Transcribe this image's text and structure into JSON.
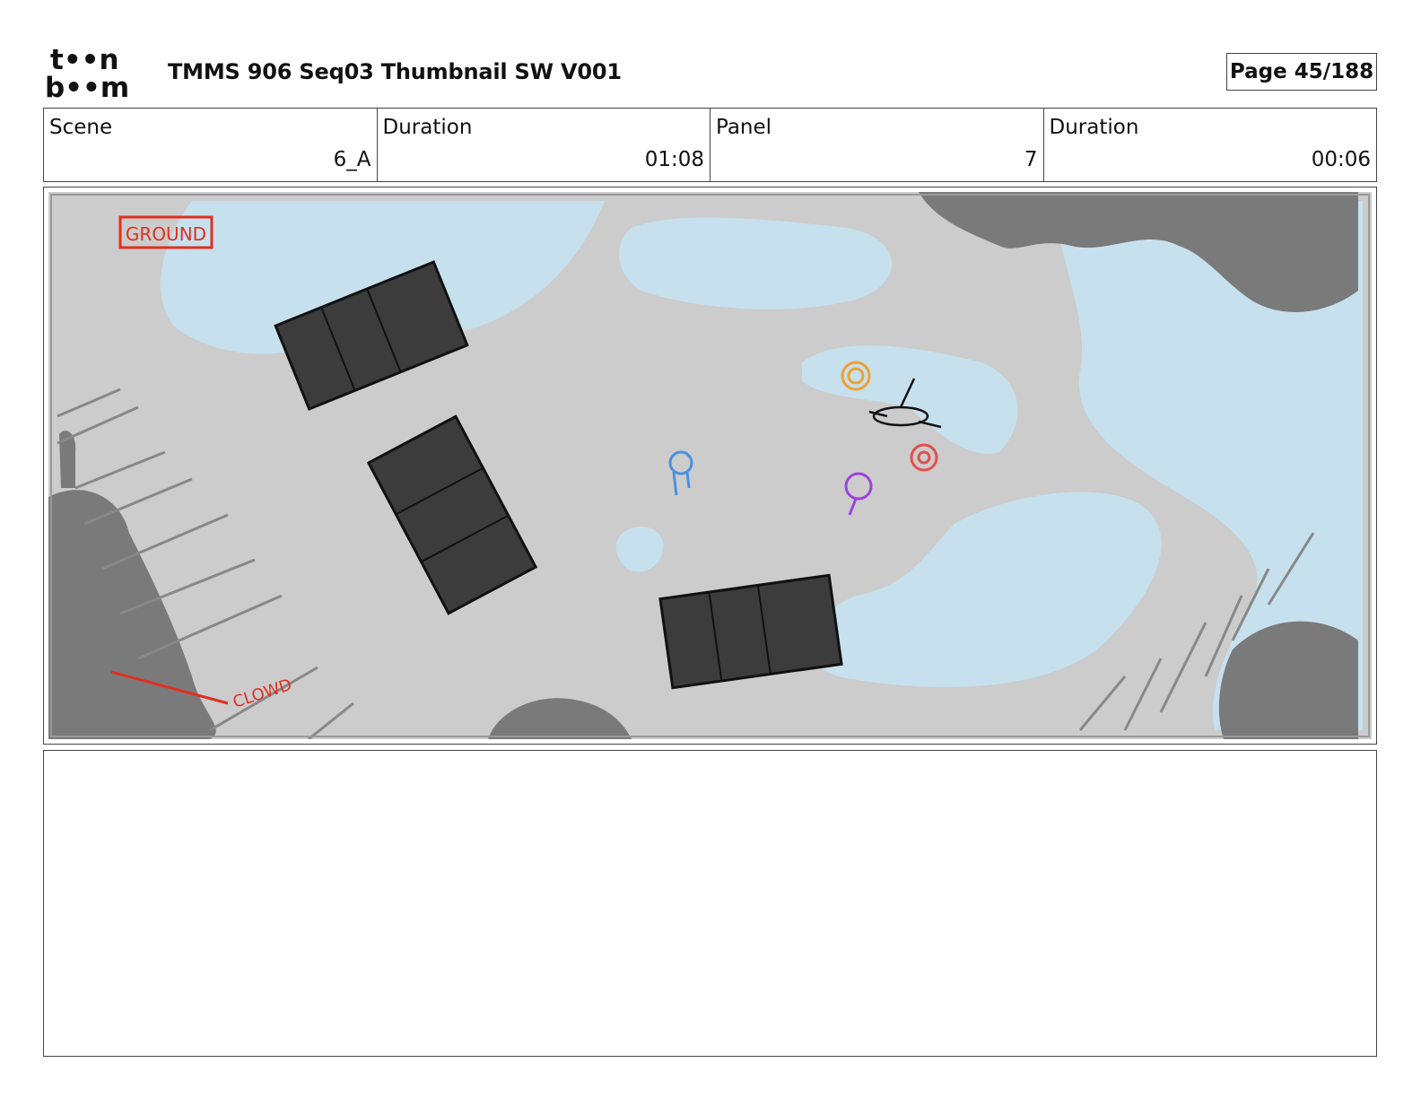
{
  "header": {
    "logo_text": [
      "t••n",
      "b••m"
    ],
    "document_title": "TMMS 906 Seq03 Thumbnail SW V001",
    "page_label": "Page",
    "page_value": "45/188"
  },
  "info": {
    "scene_label": "Scene",
    "scene_value": "6_A",
    "scene_duration_label": "Duration",
    "scene_duration_value": "01:08",
    "panel_label": "Panel",
    "panel_value": "7",
    "panel_duration_label": "Duration",
    "panel_duration_value": "00:06"
  },
  "panel": {
    "annotations": {
      "ground": "GROUND",
      "crowd": "CLOWD"
    },
    "colors": {
      "pavement": "#cccccc",
      "water": "#c6e0ee",
      "trucks": "#3c3c3c",
      "trees": "#7a7a7a",
      "annotation": "#e0301e",
      "character_blue": "#4a90e2",
      "character_orange": "#f0a030",
      "character_red": "#e05050",
      "character_purple": "#a040e0"
    }
  },
  "notes": {
    "text": ""
  }
}
